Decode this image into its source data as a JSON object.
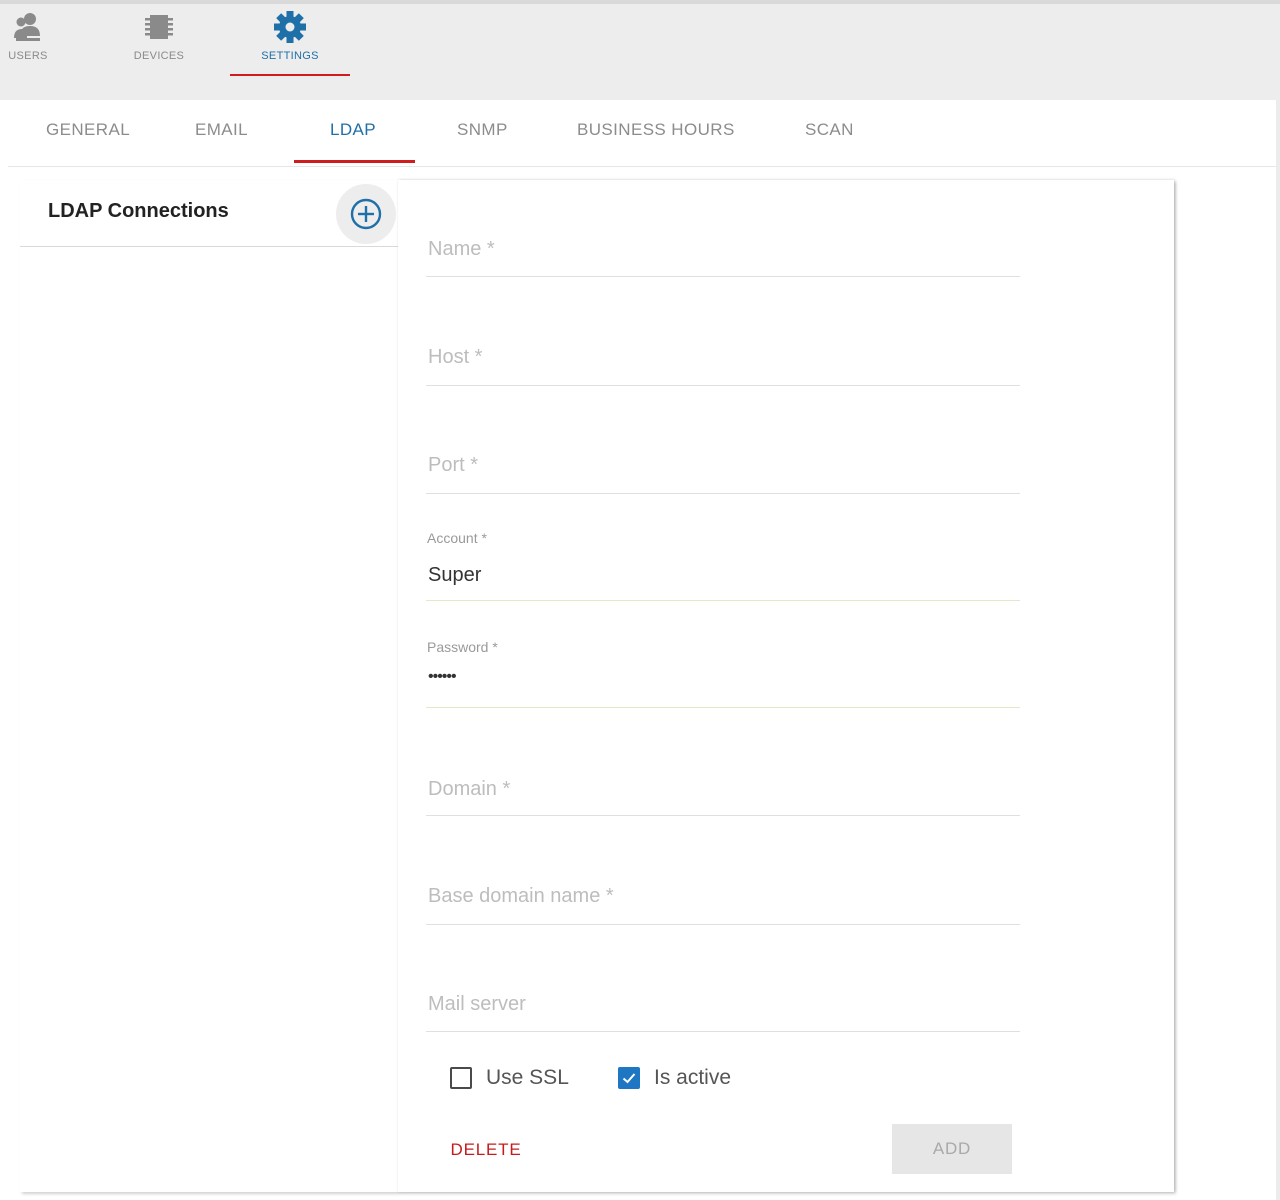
{
  "topnav": {
    "items": [
      {
        "label": "USERS",
        "icon": "users-icon"
      },
      {
        "label": "DEVICES",
        "icon": "devices-icon"
      },
      {
        "label": "SETTINGS",
        "icon": "gear-icon",
        "active": true
      }
    ]
  },
  "subtabs": [
    {
      "label": "GENERAL"
    },
    {
      "label": "EMAIL"
    },
    {
      "label": "LDAP",
      "active": true
    },
    {
      "label": "SNMP"
    },
    {
      "label": "BUSINESS HOURS"
    },
    {
      "label": "SCAN"
    }
  ],
  "left_panel": {
    "title": "LDAP Connections",
    "add_icon": "add-circle-icon"
  },
  "form": {
    "name": {
      "placeholder": "Name *",
      "value": ""
    },
    "host": {
      "placeholder": "Host *",
      "value": ""
    },
    "port": {
      "placeholder": "Port *",
      "value": ""
    },
    "account": {
      "label": "Account *",
      "value": "Super"
    },
    "password": {
      "label": "Password *",
      "value": "••••••"
    },
    "domain": {
      "placeholder": "Domain *",
      "value": ""
    },
    "base_domain_name": {
      "placeholder": "Base domain name *",
      "value": ""
    },
    "mail_server": {
      "placeholder": "Mail server",
      "value": ""
    },
    "use_ssl": {
      "label": "Use SSL",
      "checked": false
    },
    "is_active": {
      "label": "Is active",
      "checked": true
    },
    "delete_label": "DELETE",
    "add_label": "ADD"
  },
  "colors": {
    "accent": "#1f6fa8",
    "active_underline": "#d01c1c",
    "delete_text": "#c41c1c",
    "checkbox_checked": "#1f77c4"
  }
}
